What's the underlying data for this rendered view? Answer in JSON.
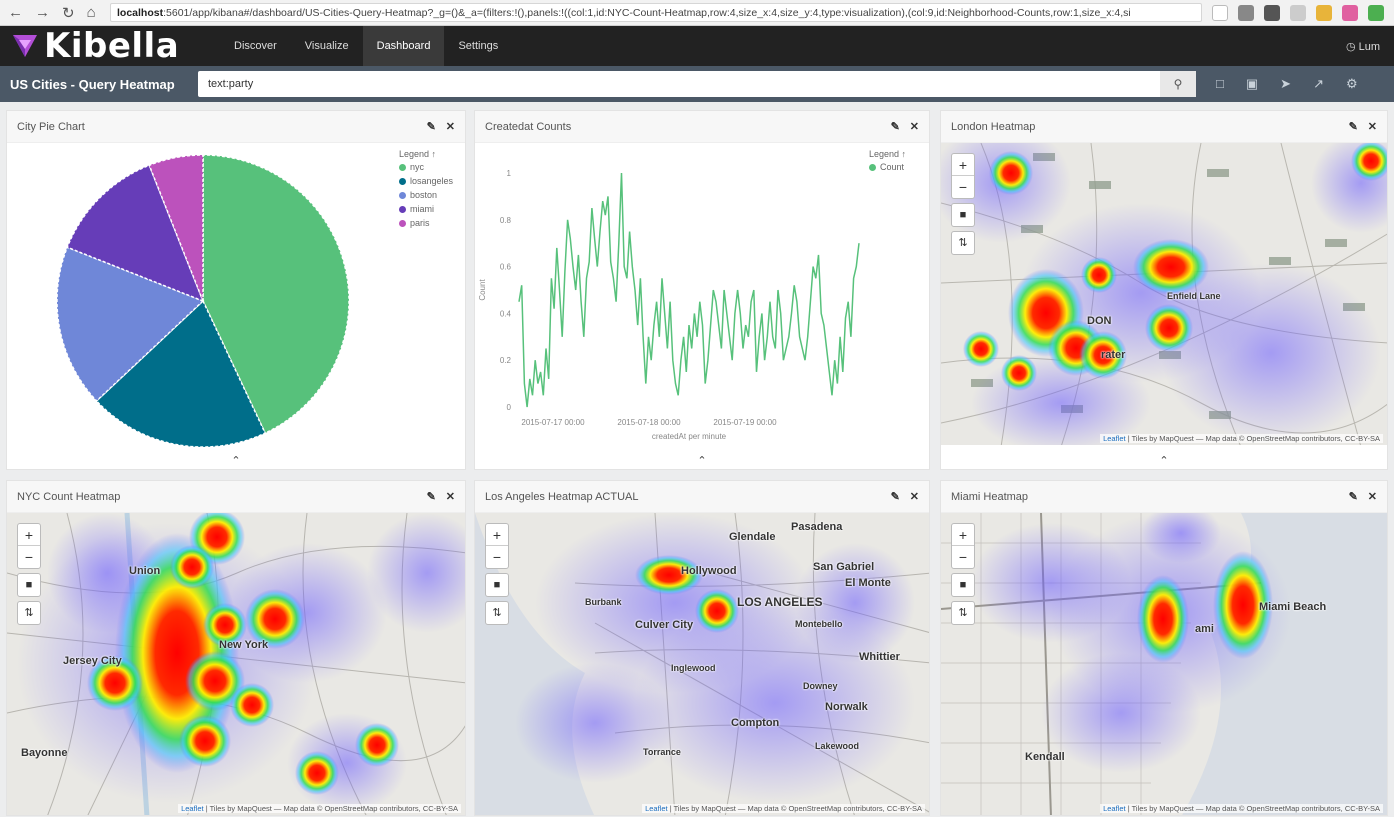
{
  "browser": {
    "url_host": "localhost",
    "url_rest": ":5601/app/kibana#/dashboard/US-Cities-Query-Heatmap?_g=()&_a=(filters:!(),panels:!((col:1,id:NYC-Count-Heatmap,row:4,size_x:4,size_y:4,type:visualization),(col:9,id:Neighborhood-Counts,row:1,size_x:4,si"
  },
  "app": {
    "logo": "Kibella",
    "user": "Lum"
  },
  "nav": [
    "Discover",
    "Visualize",
    "Dashboard",
    "Settings"
  ],
  "dashboard": {
    "title": "US Cities - Query Heatmap",
    "query": "text:party"
  },
  "panels": {
    "pie": {
      "title": "City Pie Chart",
      "legend_title": "Legend ↑",
      "legend": [
        "nyc",
        "losangeles",
        "boston",
        "miami",
        "paris"
      ],
      "colors": [
        "#57c17b",
        "#006e8a",
        "#6f87d8",
        "#663db8",
        "#bc52bc"
      ]
    },
    "line": {
      "title": "Createdat Counts",
      "legend_title": "Legend ↑",
      "legend": [
        "Count"
      ],
      "ylabel": "Count",
      "xlabel": "createdAt per minute",
      "yticks": [
        "1",
        "0.8",
        "0.6",
        "0.4",
        "0.2",
        "0"
      ],
      "xticks": [
        "2015-07-17 00:00",
        "2015-07-18 00:00",
        "2015-07-19 00:00"
      ]
    },
    "london": {
      "title": "London Heatmap",
      "labels": [
        "DON",
        "rater",
        "Enfield Lane"
      ]
    },
    "nyc": {
      "title": "NYC Count Heatmap",
      "labels": [
        "Union",
        "Jersey City",
        "New York",
        "Bayonne"
      ]
    },
    "la": {
      "title": "Los Angeles Heatmap ACTUAL",
      "labels": [
        "Pasadena",
        "Glendale",
        "Hollywood",
        "LOS ANGELES",
        "San Gabriel",
        "El Monte",
        "Culver City",
        "Montebello",
        "Whittier",
        "Inglewood",
        "Downey",
        "Compton",
        "Norwalk",
        "Torrance",
        "Lakewood",
        "Burbank"
      ]
    },
    "miami": {
      "title": "Miami Heatmap",
      "labels": [
        "Miami Beach",
        "Kendall",
        "ami"
      ]
    }
  },
  "attribution": {
    "leaflet": "Leaflet",
    "tiles": "| Tiles by MapQuest — Map data © OpenStreetMap contributors, CC-BY-SA"
  },
  "chart_data": [
    {
      "type": "pie",
      "title": "City Pie Chart",
      "categories": [
        "nyc",
        "losangeles",
        "boston",
        "miami",
        "paris"
      ],
      "values": [
        43,
        20,
        18,
        13,
        6
      ]
    },
    {
      "type": "line",
      "title": "Createdat Counts",
      "xlabel": "createdAt per minute",
      "ylabel": "Count",
      "ylim": [
        0,
        1
      ],
      "series": [
        {
          "name": "Count",
          "values": [
            0.45,
            0.52,
            0.1,
            0,
            0.12,
            0.05,
            0.2,
            0.1,
            0.15,
            0.05,
            0.25,
            0.12,
            0.55,
            0.42,
            0.68,
            0.5,
            0.3,
            0.58,
            0.8,
            0.72,
            0.6,
            0.5,
            0.65,
            0.45,
            0.3,
            0.55,
            0.62,
            0.85,
            0.72,
            0.6,
            0.75,
            0.88,
            0.82,
            0.9,
            0.62,
            0.55,
            0.45,
            0.7,
            1.0,
            0.6,
            0.55,
            0.75,
            0.6,
            0.5,
            0.35,
            0.55,
            0.3,
            0.1,
            0.3,
            0.2,
            0.35,
            0.45,
            0.3,
            0.55,
            0.4,
            0.25,
            0.45,
            0.2,
            0.1,
            0.05,
            0.2,
            0.3,
            0.15,
            0.35,
            0.25,
            0.4,
            0.3,
            0.45,
            0.35,
            0.1,
            0.2,
            0.35,
            0.5,
            0.45,
            0.35,
            0.25,
            0.5,
            0.4,
            0.3,
            0.2,
            0.4,
            0.5,
            0.4,
            0.25,
            0.35,
            0.3,
            0.45,
            0.5,
            0.15,
            0.3,
            0.4,
            0.2,
            0.3,
            0.45,
            0.3,
            0.25,
            0.5,
            0.4,
            0.2,
            0.25,
            0.3,
            0.4,
            0.52,
            0.45,
            0.3,
            0.25,
            0.2,
            0.3,
            0.45,
            0.6,
            0.55,
            0.65,
            0.4,
            0.35,
            0.25,
            0.15,
            0.05,
            0.2,
            0.1,
            0.3,
            0.15,
            0.38,
            0.45,
            0.3,
            0.55,
            0.6,
            0.7
          ]
        }
      ]
    }
  ]
}
